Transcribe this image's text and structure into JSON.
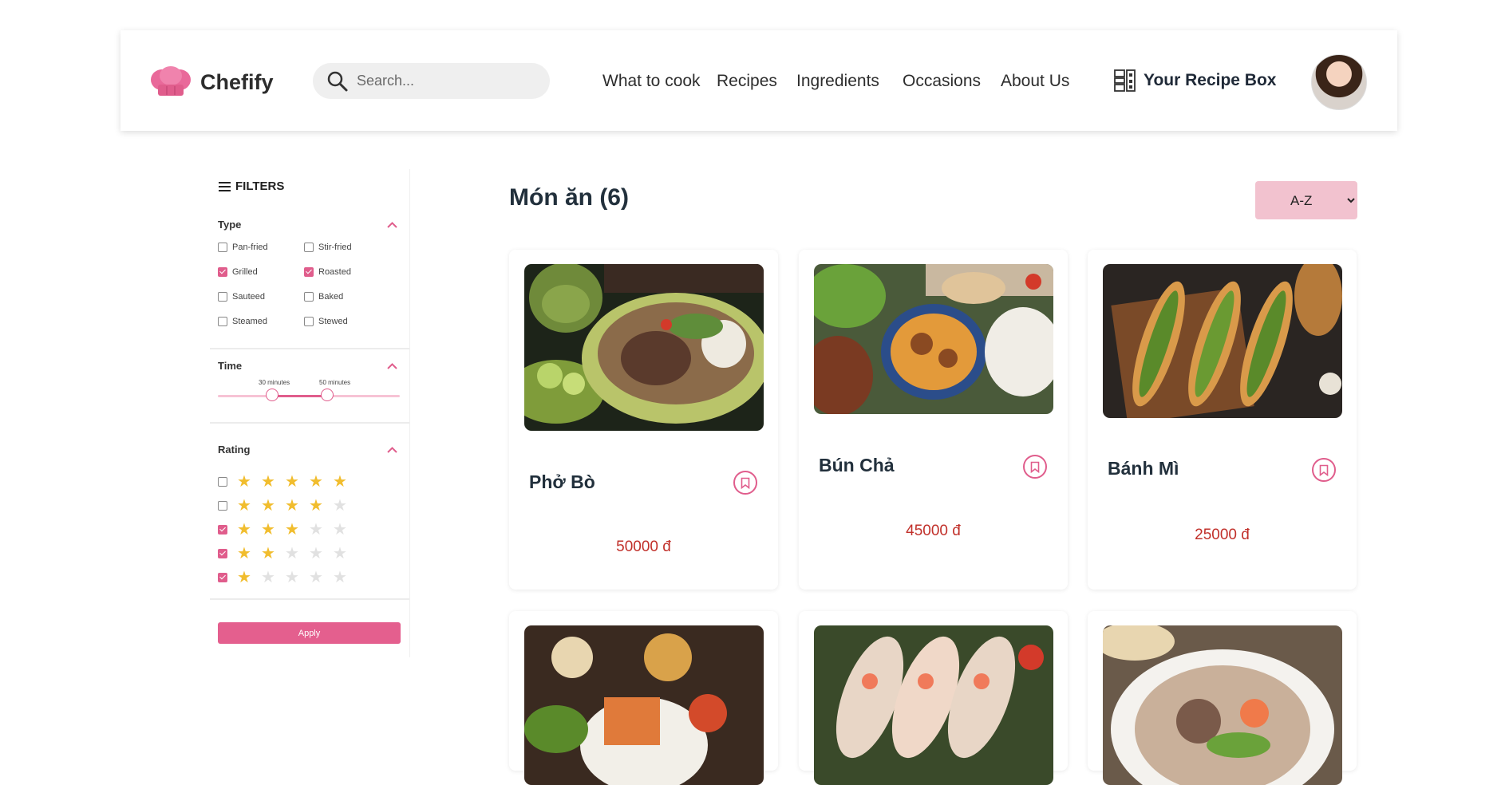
{
  "header": {
    "brand": "Chefify",
    "search_placeholder": "Search...",
    "nav": [
      "What to cook",
      "Recipes",
      "Ingredients",
      "Occasions",
      "About Us"
    ],
    "recipe_box": "Your Recipe Box"
  },
  "filters": {
    "title": "FILTERS",
    "type": {
      "title": "Type",
      "options": [
        {
          "label": "Pan-fried",
          "checked": false
        },
        {
          "label": "Stir-fried",
          "checked": false
        },
        {
          "label": "Grilled",
          "checked": true
        },
        {
          "label": "Roasted",
          "checked": true
        },
        {
          "label": "Sauteed",
          "checked": false
        },
        {
          "label": "Baked",
          "checked": false
        },
        {
          "label": "Steamed",
          "checked": false
        },
        {
          "label": "Stewed",
          "checked": false
        }
      ]
    },
    "time": {
      "title": "Time",
      "min_label": "30 minutes",
      "max_label": "50 minutes",
      "min_fraction": 0.3,
      "max_fraction": 0.6
    },
    "rating": {
      "title": "Rating",
      "rows": [
        {
          "stars": 5,
          "checked": false
        },
        {
          "stars": 4,
          "checked": false
        },
        {
          "stars": 3,
          "checked": true
        },
        {
          "stars": 2,
          "checked": true
        },
        {
          "stars": 1,
          "checked": true
        }
      ]
    },
    "apply_label": "Apply"
  },
  "main": {
    "title": "Món ăn (6)",
    "sort_options": [
      "A-Z"
    ],
    "sort_value": "A-Z",
    "cards": [
      {
        "name": "Phở Bò",
        "price": "50000 đ"
      },
      {
        "name": "Bún Chả",
        "price": "45000 đ"
      },
      {
        "name": "Bánh Mì",
        "price": "25000 đ"
      }
    ]
  },
  "icons": {
    "search": "search-icon",
    "recipe_box": "recipe-box-icon",
    "bookmark": "bookmark-icon",
    "menu": "menu-icon",
    "chevron": "chevron-up-icon"
  },
  "colors": {
    "accent": "#e05d8c",
    "price": "#c1302a",
    "star": "#f1bd2e",
    "sort_bg": "#f2c2cf"
  }
}
